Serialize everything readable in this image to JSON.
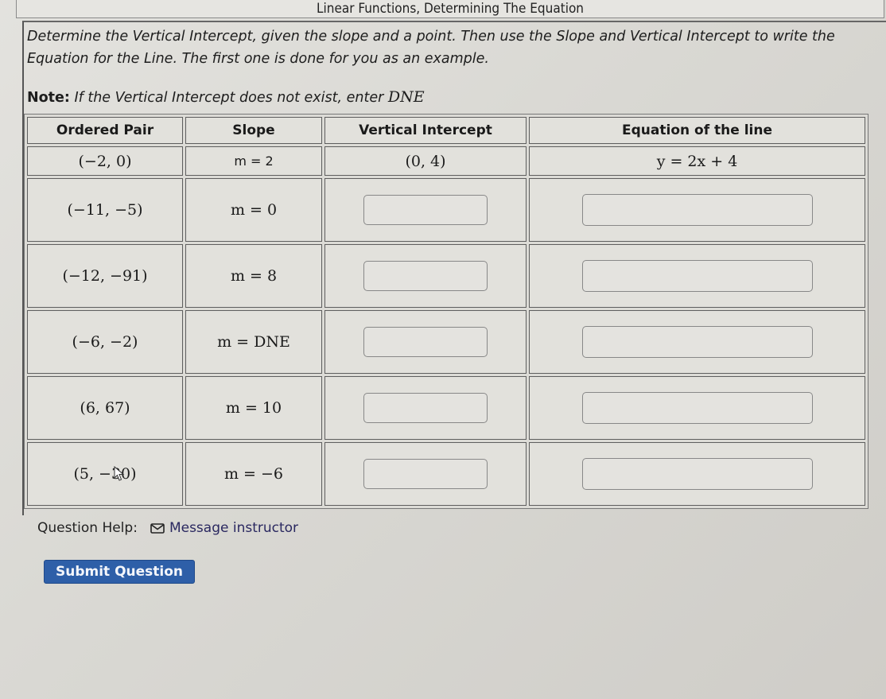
{
  "page": {
    "title": "Linear Functions, Determining The Equation"
  },
  "instructions": {
    "text": "Determine the Vertical Intercept, given the slope and a point. Then use the Slope and Vertical Intercept to write the Equation for the Line. The first one is done for you as an example.",
    "note_label": "Note:",
    "note_text": " If the Vertical Intercept does not exist, enter ",
    "note_math": "DNE"
  },
  "table": {
    "headers": [
      "Ordered Pair",
      "Slope",
      "Vertical Intercept",
      "Equation of the line"
    ],
    "example": {
      "ordered_pair": "(−2, 0)",
      "slope": "m = 2",
      "vertical_intercept": "(0, 4)",
      "equation": "y = 2x + 4"
    },
    "rows": [
      {
        "ordered_pair": "(−11, −5)",
        "slope": "m = 0",
        "vertical_intercept_value": "",
        "equation_value": ""
      },
      {
        "ordered_pair": "(−12, −91)",
        "slope": "m = 8",
        "vertical_intercept_value": "",
        "equation_value": ""
      },
      {
        "ordered_pair": "(−6, −2)",
        "slope": "m = DNE",
        "vertical_intercept_value": "",
        "equation_value": ""
      },
      {
        "ordered_pair": "(6, 67)",
        "slope": "m = 10",
        "vertical_intercept_value": "",
        "equation_value": ""
      },
      {
        "ordered_pair": "(5, −30)",
        "slope": "m = −6",
        "vertical_intercept_value": "",
        "equation_value": ""
      }
    ]
  },
  "help": {
    "label": "Question Help:",
    "message_link": "Message instructor",
    "icon": "mail-icon"
  },
  "actions": {
    "submit_label": "Submit Question"
  },
  "colors": {
    "submit_button": "#2e5fa8",
    "link": "#2a2860"
  }
}
